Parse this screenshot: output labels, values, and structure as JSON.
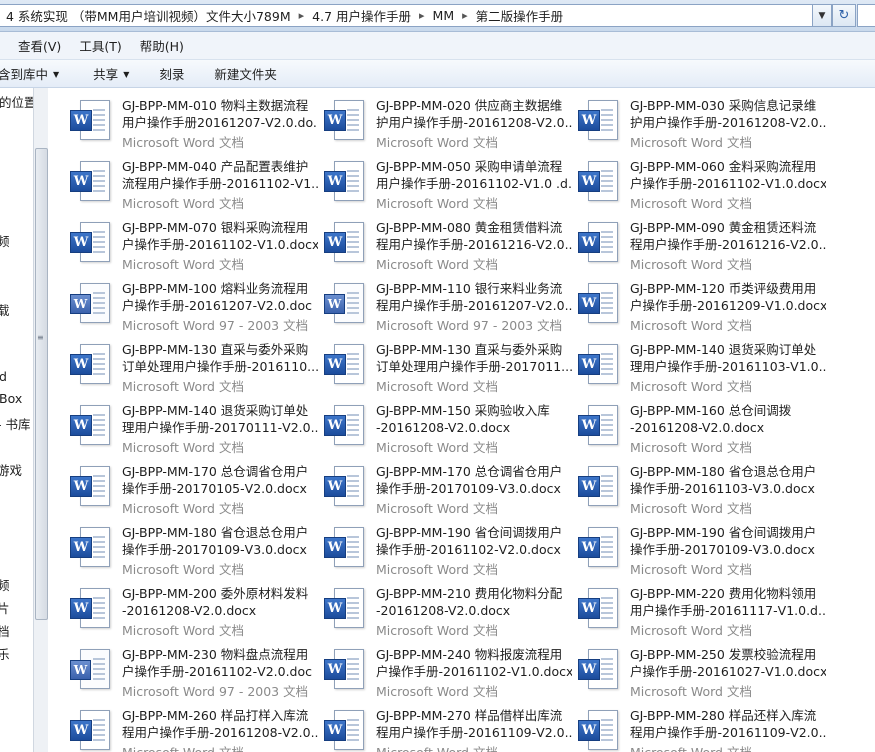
{
  "address_bar": {
    "segments": [
      "4 系统实现 （带MM用户培训视频）文件大小789M",
      "4.7 用户操作手册",
      "MM",
      "第二版操作手册"
    ],
    "separator": "▸"
  },
  "menu": [
    "查看(V)",
    "工具(T)",
    "帮助(H)"
  ],
  "menu_first_partial": "查看(V)",
  "commands": [
    "含到库中",
    "共享",
    "刻录",
    "新建文件夹"
  ],
  "nav_pane": {
    "items": [
      "的位置",
      "频",
      "载",
      "d",
      "Box",
      "- 书库",
      "游戏",
      "频",
      "片",
      "档",
      "乐"
    ]
  },
  "files": [
    {
      "name": [
        "GJ-BPP-MM-010 物料主数据流程",
        "用户操作手册20161207-V2.0.do..."
      ],
      "type": "Microsoft Word 文档",
      "old": false
    },
    {
      "name": [
        "GJ-BPP-MM-020 供应商主数据维",
        "护用户操作手册-20161208-V2.0...."
      ],
      "type": "Microsoft Word 文档",
      "old": false
    },
    {
      "name": [
        "GJ-BPP-MM-030 采购信息记录维",
        "护用户操作手册-20161208-V2.0...."
      ],
      "type": "Microsoft Word 文档",
      "old": false
    },
    {
      "name": [
        "GJ-BPP-MM-040 产品配置表维护",
        "流程用户操作手册-20161102-V1..."
      ],
      "type": "Microsoft Word 文档",
      "old": false
    },
    {
      "name": [
        "GJ-BPP-MM-050 采购申请单流程",
        "用户操作手册-20161102-V1.0 .d..."
      ],
      "type": "Microsoft Word 文档",
      "old": false
    },
    {
      "name": [
        "GJ-BPP-MM-060 金料采购流程用",
        "户操作手册-20161102-V1.0.docx"
      ],
      "type": "Microsoft Word 文档",
      "old": false
    },
    {
      "name": [
        "GJ-BPP-MM-070 银料采购流程用",
        "户操作手册-20161102-V1.0.docx"
      ],
      "type": "Microsoft Word 文档",
      "old": false
    },
    {
      "name": [
        "GJ-BPP-MM-080 黄金租赁借料流",
        "程用户操作手册-20161216-V2.0...."
      ],
      "type": "Microsoft Word 文档",
      "old": false
    },
    {
      "name": [
        "GJ-BPP-MM-090 黄金租赁还料流",
        "程用户操作手册-20161216-V2.0...."
      ],
      "type": "Microsoft Word 文档",
      "old": false
    },
    {
      "name": [
        "GJ-BPP-MM-100 熔料业务流程用",
        "户操作手册-20161207-V2.0.doc"
      ],
      "type": "Microsoft Word 97 - 2003 文档",
      "old": true
    },
    {
      "name": [
        "GJ-BPP-MM-110 银行来料业务流",
        "程用户操作手册-20161207-V2.0...."
      ],
      "type": "Microsoft Word 97 - 2003 文档",
      "old": true
    },
    {
      "name": [
        "GJ-BPP-MM-120 币类评级费用用",
        "户操作手册-20161209-V1.0.docx"
      ],
      "type": "Microsoft Word 文档",
      "old": false
    },
    {
      "name": [
        "GJ-BPP-MM-130 直采与委外采购",
        "订单处理用户操作手册-2016110..."
      ],
      "type": "Microsoft Word 文档",
      "old": false
    },
    {
      "name": [
        "GJ-BPP-MM-130 直采与委外采购",
        "订单处理用户操作手册-2017011..."
      ],
      "type": "Microsoft Word 文档",
      "old": false
    },
    {
      "name": [
        "GJ-BPP-MM-140 退货采购订单处",
        "理用户操作手册-20161103-V1.0...."
      ],
      "type": "Microsoft Word 文档",
      "old": false
    },
    {
      "name": [
        "GJ-BPP-MM-140 退货采购订单处",
        "理用户操作手册-20170111-V2.0...."
      ],
      "type": "Microsoft Word 文档",
      "old": false
    },
    {
      "name": [
        "GJ-BPP-MM-150 采购验收入库",
        "-20161208-V2.0.docx"
      ],
      "type": "Microsoft Word 文档",
      "old": false
    },
    {
      "name": [
        "GJ-BPP-MM-160 总仓间调拨",
        "-20161208-V2.0.docx"
      ],
      "type": "Microsoft Word 文档",
      "old": false
    },
    {
      "name": [
        "GJ-BPP-MM-170 总仓调省仓用户",
        "操作手册-20170105-V2.0.docx"
      ],
      "type": "Microsoft Word 文档",
      "old": false
    },
    {
      "name": [
        "GJ-BPP-MM-170 总仓调省仓用户",
        "操作手册-20170109-V3.0.docx"
      ],
      "type": "Microsoft Word 文档",
      "old": false
    },
    {
      "name": [
        "GJ-BPP-MM-180 省仓退总仓用户",
        "操作手册-20161103-V3.0.docx"
      ],
      "type": "Microsoft Word 文档",
      "old": false
    },
    {
      "name": [
        "GJ-BPP-MM-180 省仓退总仓用户",
        "操作手册-20170109-V3.0.docx"
      ],
      "type": "Microsoft Word 文档",
      "old": false
    },
    {
      "name": [
        "GJ-BPP-MM-190 省仓间调拨用户",
        "操作手册-20161102-V2.0.docx"
      ],
      "type": "Microsoft Word 文档",
      "old": false
    },
    {
      "name": [
        "GJ-BPP-MM-190 省仓间调拨用户",
        "操作手册-20170109-V3.0.docx"
      ],
      "type": "Microsoft Word 文档",
      "old": false
    },
    {
      "name": [
        "GJ-BPP-MM-200 委外原材料发料",
        "-20161208-V2.0.docx"
      ],
      "type": "Microsoft Word 文档",
      "old": false
    },
    {
      "name": [
        "GJ-BPP-MM-210 费用化物料分配",
        "-20161208-V2.0.docx"
      ],
      "type": "Microsoft Word 文档",
      "old": false
    },
    {
      "name": [
        "GJ-BPP-MM-220 费用化物料领用",
        "用户操作手册-20161117-V1.0.d..."
      ],
      "type": "Microsoft Word 文档",
      "old": false
    },
    {
      "name": [
        "GJ-BPP-MM-230 物料盘点流程用",
        "户操作手册-20161102-V2.0.doc"
      ],
      "type": "Microsoft Word 97 - 2003 文档",
      "old": true
    },
    {
      "name": [
        "GJ-BPP-MM-240 物料报废流程用",
        "户操作手册-20161102-V1.0.docx"
      ],
      "type": "Microsoft Word 文档",
      "old": false
    },
    {
      "name": [
        "GJ-BPP-MM-250 发票校验流程用",
        "户操作手册-20161027-V1.0.docx"
      ],
      "type": "Microsoft Word 文档",
      "old": false
    },
    {
      "name": [
        "GJ-BPP-MM-260 样品打样入库流",
        "程用户操作手册-20161208-V2.0...."
      ],
      "type": "Microsoft Word 文档",
      "old": false
    },
    {
      "name": [
        "GJ-BPP-MM-270 样品借样出库流",
        "程用户操作手册-20161109-V2.0...."
      ],
      "type": "Microsoft Word 文档",
      "old": false
    },
    {
      "name": [
        "GJ-BPP-MM-280 样品还样入库流",
        "程用户操作手册-20161109-V2.0...."
      ],
      "type": "Microsoft Word 文档",
      "old": false
    }
  ]
}
